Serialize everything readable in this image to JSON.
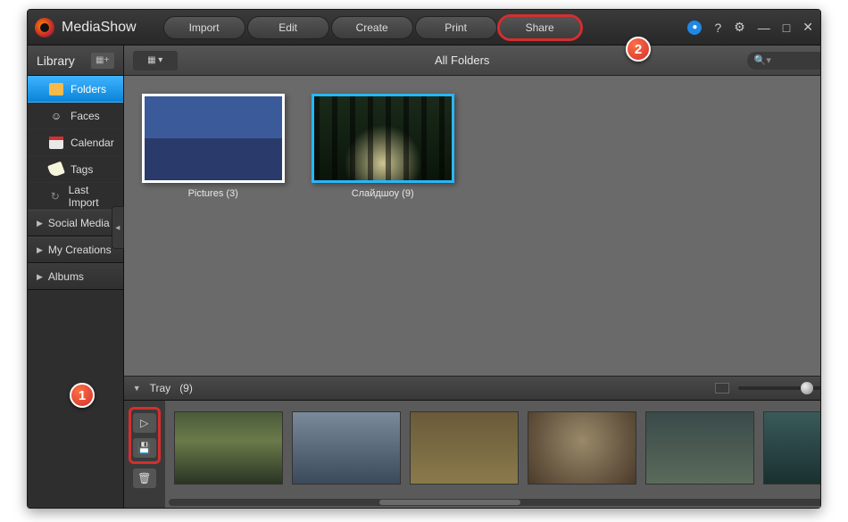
{
  "app_title": "MediaShow",
  "tabs": [
    "Import",
    "Edit",
    "Create",
    "Print",
    "Share"
  ],
  "highlighted_tab": "Share",
  "sidebar": {
    "header": "Library",
    "items": [
      {
        "label": "Folders",
        "icon": "folder",
        "active": true
      },
      {
        "label": "Faces",
        "icon": "faces"
      },
      {
        "label": "Calendar",
        "icon": "calendar"
      },
      {
        "label": "Tags",
        "icon": "tag"
      },
      {
        "label": "Last Import",
        "icon": "last-import"
      }
    ],
    "categories": [
      "Social Media",
      "My Creations",
      "Albums"
    ]
  },
  "toolbar": {
    "title": "All Folders",
    "search_placeholder": ""
  },
  "folders": [
    {
      "label": "Pictures (3)",
      "selected": false,
      "art": "art1"
    },
    {
      "label": "Слайдшоу (9)",
      "selected": true,
      "art": "art2"
    }
  ],
  "tray": {
    "label_prefix": "",
    "label": "Tray",
    "count": "(9)"
  },
  "callouts": {
    "one": "1",
    "two": "2"
  },
  "title_icons": {
    "help": "?",
    "settings": "✶",
    "min": "—",
    "max": "□",
    "close": "✕"
  }
}
